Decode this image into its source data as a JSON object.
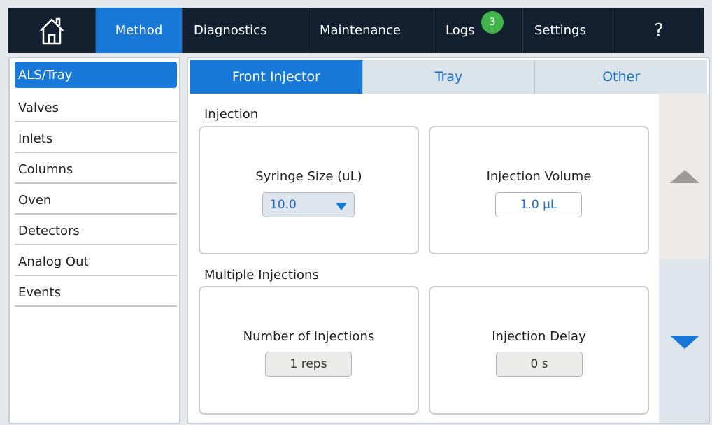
{
  "nav": {
    "home_icon": "home-icon",
    "tabs": [
      {
        "label": "Method",
        "active": true
      },
      {
        "label": "Diagnostics",
        "active": false
      },
      {
        "label": "Maintenance",
        "active": false
      },
      {
        "label": "Logs",
        "active": false,
        "badge": "3"
      },
      {
        "label": "Settings",
        "active": false
      }
    ],
    "help": "?"
  },
  "sidebar": {
    "items": [
      {
        "label": "ALS/Tray",
        "active": true
      },
      {
        "label": "Valves"
      },
      {
        "label": "Inlets"
      },
      {
        "label": "Columns"
      },
      {
        "label": "Oven"
      },
      {
        "label": "Detectors"
      },
      {
        "label": "Analog Out"
      },
      {
        "label": "Events"
      }
    ]
  },
  "tabs": [
    {
      "label": "Front Injector",
      "active": true
    },
    {
      "label": "Tray",
      "active": false
    },
    {
      "label": "Other",
      "active": false
    }
  ],
  "injection": {
    "title": "Injection",
    "syringe_label": "Syringe Size (uL)",
    "syringe_value": "10.0",
    "volume_label": "Injection Volume",
    "volume_value": "1.0 µL"
  },
  "multiple": {
    "title": "Multiple Injections",
    "count_label": "Number of Injections",
    "count_value": "1 reps",
    "delay_label": "Injection Delay",
    "delay_value": "0 s"
  },
  "colors": {
    "nav_bg": "#13202f",
    "accent": "#1778d7",
    "badge": "#41b54a"
  }
}
